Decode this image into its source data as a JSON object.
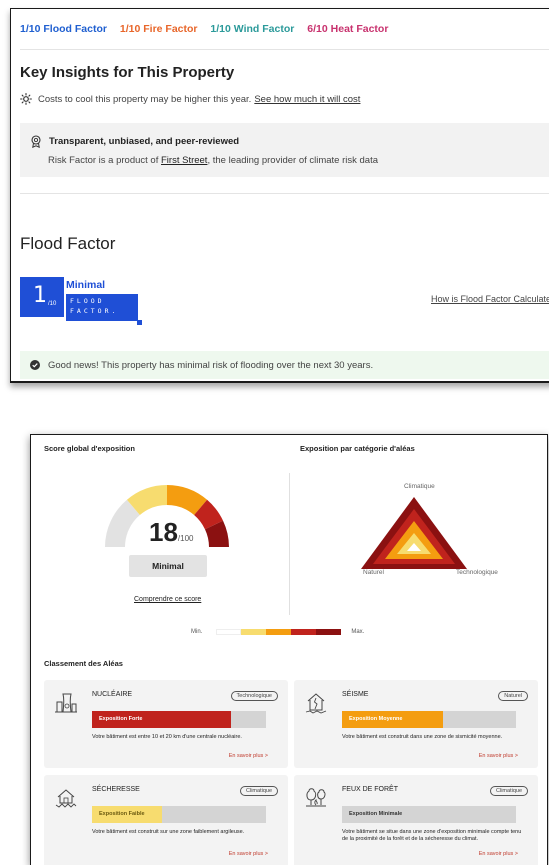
{
  "risk_header": {
    "flood": {
      "score": "1/10",
      "label": "Flood Factor"
    },
    "fire": {
      "score": "1/10",
      "label": "Fire Factor"
    },
    "wind": {
      "score": "1/10",
      "label": "Wind Factor"
    },
    "heat": {
      "score": "6/10",
      "label": "Heat Factor"
    }
  },
  "insights": {
    "title": "Key Insights for This Property",
    "heat_text": "Costs to cool this property may be higher this year.",
    "heat_link": "See how much it will cost",
    "transparency_title": "Transparent, unbiased, and peer-reviewed",
    "transparency_text": "Risk Factor is a product of",
    "transparency_link": "First Street",
    "transparency_suffix": ", the leading provider of climate risk data"
  },
  "flood_factor": {
    "title": "Flood Factor",
    "score": "1",
    "denominator": "/10",
    "level": "Minimal",
    "logo_line1": "FLOOD",
    "logo_line2": "FACTOR.",
    "how_link": "How is Flood Factor Calculated?",
    "good_news": "Good news! This property has minimal risk of flooding over the next 30 years."
  },
  "exposure": {
    "global_title": "Score global d'exposition",
    "category_title": "Exposition par catégorie d'aléas",
    "score": "18",
    "score_max": "/100",
    "level": "Minimal",
    "comprendre_link": "Comprendre ce score",
    "triangle_top": "Climatique",
    "triangle_left": "Naturel",
    "triangle_right": "Technologique",
    "legend_min": "Min.",
    "legend_max": "Max.",
    "classement_title": "Classement des Aléas"
  },
  "hazards": [
    {
      "name": "NUCLÉAIRE",
      "tag": "Technologique",
      "level": "Exposition Forte",
      "fill": 0.8,
      "fill_color": "#c0231d",
      "level_color": "#ffffff",
      "desc": "Votre bâtiment est entre 10 et 20 km d'une centrale nucléaire.",
      "more": "En savoir plus >"
    },
    {
      "name": "SÉISME",
      "tag": "Naturel",
      "level": "Exposition Moyenne",
      "fill": 0.58,
      "fill_color": "#f49d10",
      "level_color": "#ffffff",
      "desc": "Votre bâtiment est construit dans une zone de sismicité moyenne.",
      "more": "En savoir plus >"
    },
    {
      "name": "SÉCHERESSE",
      "tag": "Climatique",
      "level": "Exposition Faible",
      "fill": 0.4,
      "fill_color": "#f7dc6f",
      "level_color": "#6b5a10",
      "desc": "Votre bâtiment est construit sur une zone faiblement argileuse.",
      "more": "En savoir plus >"
    },
    {
      "name": "FEUX DE FORÊT",
      "tag": "Climatique",
      "level": "Exposition Minimale",
      "fill": 0.0,
      "fill_color": "#d4d4d4",
      "level_color": "#333333",
      "desc": "Votre bâtiment se situe dans une zone d'exposition minimale compte tenu de la proximité de la forêt et de la sécheresse du climat.",
      "more": "En savoir plus >"
    }
  ],
  "colors": {
    "flood": "#1f5fd0",
    "fire": "#e8662a",
    "wind": "#2b9a9a",
    "heat": "#c8326e",
    "brand_blue": "#1f4fd6",
    "scale": [
      "#ffffff",
      "#f7dc6f",
      "#f49d10",
      "#c0231d",
      "#8b1111"
    ]
  },
  "icons": [
    "sun-icon",
    "medal-icon",
    "check-circle-icon",
    "nuclear-plant-icon",
    "earthquake-house-icon",
    "drought-house-icon",
    "forest-fire-icon"
  ]
}
